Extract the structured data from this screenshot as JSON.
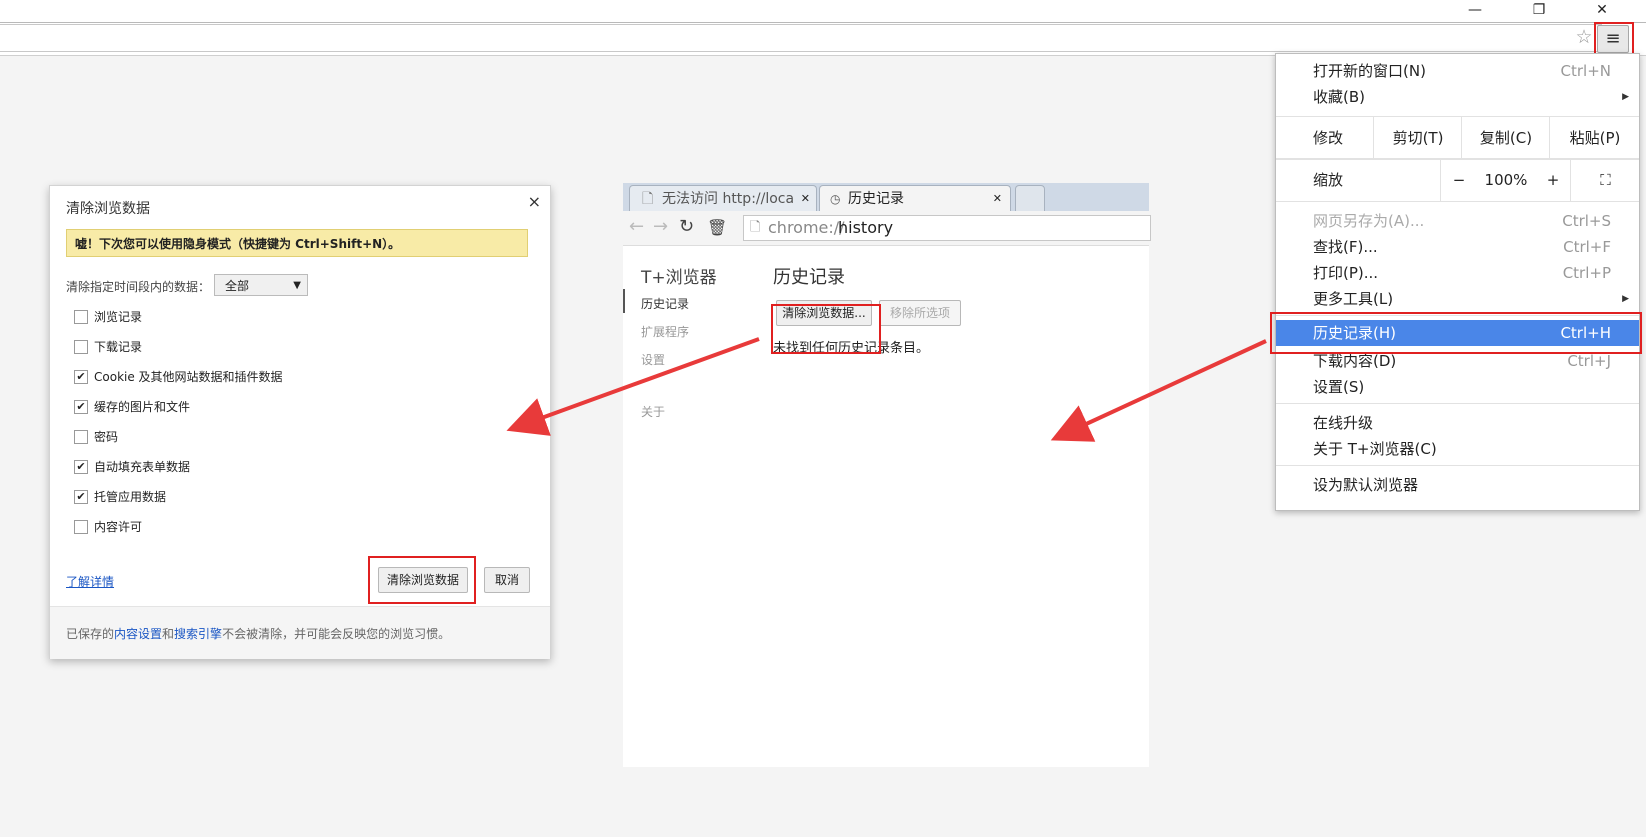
{
  "window": {
    "minimize_glyph": "—",
    "restore_glyph": "❐",
    "close_glyph": "✕"
  },
  "toolbar": {
    "star_glyph": "☆",
    "menu_glyph": "≡"
  },
  "menu": {
    "new_window": "打开新的窗口(N)",
    "new_window_sc": "Ctrl+N",
    "bookmarks": "收藏(B)",
    "edit": {
      "label": "修改",
      "cut": "剪切(T)",
      "copy": "复制(C)",
      "paste": "粘贴(P)"
    },
    "zoom": {
      "label": "缩放",
      "minus": "−",
      "value": "100%",
      "plus": "+",
      "fullscreen": "⛶"
    },
    "save_as": "网页另存为(A)...",
    "save_as_sc": "Ctrl+S",
    "find": "查找(F)...",
    "find_sc": "Ctrl+F",
    "print": "打印(P)...",
    "print_sc": "Ctrl+P",
    "more_tools": "更多工具(L)",
    "history": "历史记录(H)",
    "history_sc": "Ctrl+H",
    "downloads": "下载内容(D)",
    "downloads_sc": "Ctrl+J",
    "settings": "设置(S)",
    "upgrade": "在线升级",
    "about": "关于 T+浏览器(C)",
    "default_browser": "设为默认浏览器"
  },
  "history_page": {
    "tab1": "无法访问 http://loca",
    "tab2": "历史记录",
    "url_scheme": "chrome://",
    "url_path": "history",
    "brand": "T+浏览器",
    "side": [
      "历史记录",
      "扩展程序",
      "设置",
      "关于"
    ],
    "title": "历史记录",
    "clear_btn": "清除浏览数据...",
    "remove_btn": "移除所选项",
    "empty_msg": "未找到任何历史记录条目。"
  },
  "dialog": {
    "title": "清除浏览数据",
    "close": "×",
    "tip": "嘘！下次您可以使用隐身模式（快捷键为 Ctrl+Shift+N）。",
    "range_label": "清除指定时间段内的数据：",
    "range_value": "全部",
    "items": [
      {
        "label": "浏览记录",
        "checked": false
      },
      {
        "label": "下载记录",
        "checked": false
      },
      {
        "label": "Cookie 及其他网站数据和插件数据",
        "checked": true
      },
      {
        "label": "缓存的图片和文件",
        "checked": true
      },
      {
        "label": "密码",
        "checked": false
      },
      {
        "label": "自动填充表单数据",
        "checked": true
      },
      {
        "label": "托管应用数据",
        "checked": true
      },
      {
        "label": "内容许可",
        "checked": false
      }
    ],
    "learn_more": "了解详情",
    "clear_btn": "清除浏览数据",
    "cancel_btn": "取消",
    "footer_pre": "已保存的",
    "footer_link1": "内容设置",
    "footer_and": "和",
    "footer_link2": "搜索引擎",
    "footer_post": "不会被清除，并可能会反映您的浏览习惯。"
  },
  "colors": {
    "highlight": "#4a86e8",
    "annotation_red": "#e02020",
    "tip_bg": "#f8eba7"
  }
}
